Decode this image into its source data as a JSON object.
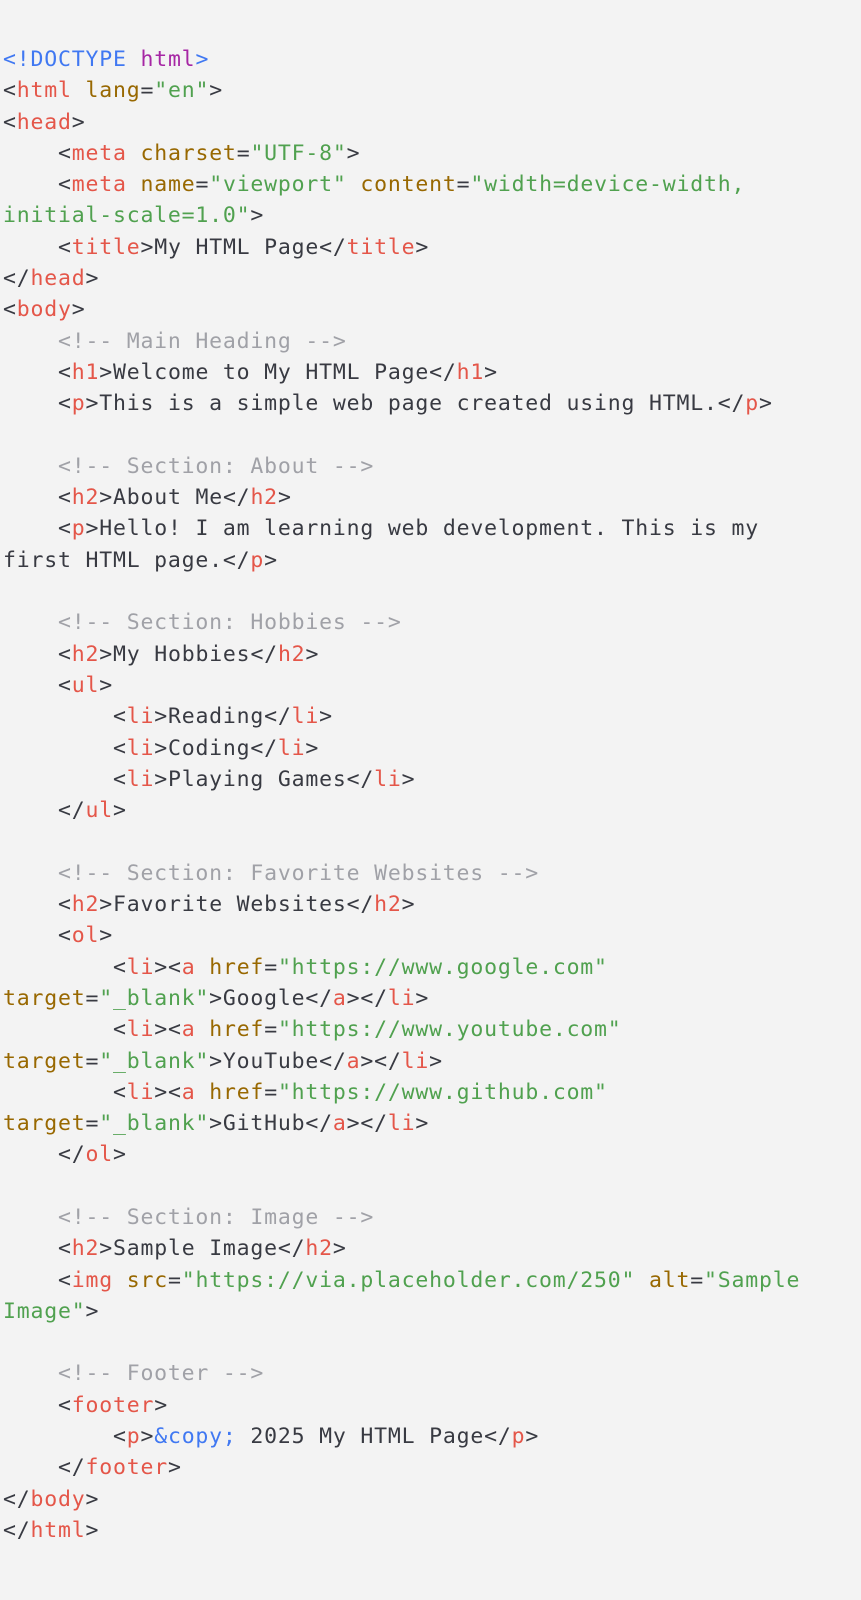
{
  "colors": {
    "background": "#f3f3f3",
    "doctype": "#4078f2",
    "keyword": "#a626a4",
    "punctuation": "#383a42",
    "tag": "#e45649",
    "attribute": "#986801",
    "string": "#50a14f",
    "text": "#383a42",
    "comment": "#a0a1a7",
    "entity": "#4078f2"
  },
  "code": {
    "lines": [
      [
        {
          "t": "doctype",
          "v": "<!DOCTYPE "
        },
        {
          "t": "kw",
          "v": "html"
        },
        {
          "t": "doctype",
          "v": ">"
        }
      ],
      [
        {
          "t": "punc",
          "v": "<"
        },
        {
          "t": "tag",
          "v": "html"
        },
        {
          "t": "punc",
          "v": " "
        },
        {
          "t": "attr",
          "v": "lang"
        },
        {
          "t": "punc",
          "v": "="
        },
        {
          "t": "str",
          "v": "\"en\""
        },
        {
          "t": "punc",
          "v": ">"
        }
      ],
      [
        {
          "t": "punc",
          "v": "<"
        },
        {
          "t": "tag",
          "v": "head"
        },
        {
          "t": "punc",
          "v": ">"
        }
      ],
      [
        {
          "t": "punc",
          "v": "    <"
        },
        {
          "t": "tag",
          "v": "meta"
        },
        {
          "t": "punc",
          "v": " "
        },
        {
          "t": "attr",
          "v": "charset"
        },
        {
          "t": "punc",
          "v": "="
        },
        {
          "t": "str",
          "v": "\"UTF-8\""
        },
        {
          "t": "punc",
          "v": ">"
        }
      ],
      [
        {
          "t": "punc",
          "v": "    <"
        },
        {
          "t": "tag",
          "v": "meta"
        },
        {
          "t": "punc",
          "v": " "
        },
        {
          "t": "attr",
          "v": "name"
        },
        {
          "t": "punc",
          "v": "="
        },
        {
          "t": "str",
          "v": "\"viewport\""
        },
        {
          "t": "punc",
          "v": " "
        },
        {
          "t": "attr",
          "v": "content"
        },
        {
          "t": "punc",
          "v": "="
        },
        {
          "t": "str",
          "v": "\"width=device-width,"
        }
      ],
      [
        {
          "t": "str",
          "v": "initial-scale=1.0\""
        },
        {
          "t": "punc",
          "v": ">"
        }
      ],
      [
        {
          "t": "punc",
          "v": "    <"
        },
        {
          "t": "tag",
          "v": "title"
        },
        {
          "t": "punc",
          "v": ">"
        },
        {
          "t": "text",
          "v": "My HTML Page"
        },
        {
          "t": "punc",
          "v": "</"
        },
        {
          "t": "tag",
          "v": "title"
        },
        {
          "t": "punc",
          "v": ">"
        }
      ],
      [
        {
          "t": "punc",
          "v": "</"
        },
        {
          "t": "tag",
          "v": "head"
        },
        {
          "t": "punc",
          "v": ">"
        }
      ],
      [
        {
          "t": "punc",
          "v": "<"
        },
        {
          "t": "tag",
          "v": "body"
        },
        {
          "t": "punc",
          "v": ">"
        }
      ],
      [
        {
          "t": "comment",
          "v": "    <!-- Main Heading -->"
        }
      ],
      [
        {
          "t": "punc",
          "v": "    <"
        },
        {
          "t": "tag",
          "v": "h1"
        },
        {
          "t": "punc",
          "v": ">"
        },
        {
          "t": "text",
          "v": "Welcome to My HTML Page"
        },
        {
          "t": "punc",
          "v": "</"
        },
        {
          "t": "tag",
          "v": "h1"
        },
        {
          "t": "punc",
          "v": ">"
        }
      ],
      [
        {
          "t": "punc",
          "v": "    <"
        },
        {
          "t": "tag",
          "v": "p"
        },
        {
          "t": "punc",
          "v": ">"
        },
        {
          "t": "text",
          "v": "This is a simple web page created using HTML."
        },
        {
          "t": "punc",
          "v": "</"
        },
        {
          "t": "tag",
          "v": "p"
        },
        {
          "t": "punc",
          "v": ">"
        }
      ],
      [],
      [
        {
          "t": "comment",
          "v": "    <!-- Section: About -->"
        }
      ],
      [
        {
          "t": "punc",
          "v": "    <"
        },
        {
          "t": "tag",
          "v": "h2"
        },
        {
          "t": "punc",
          "v": ">"
        },
        {
          "t": "text",
          "v": "About Me"
        },
        {
          "t": "punc",
          "v": "</"
        },
        {
          "t": "tag",
          "v": "h2"
        },
        {
          "t": "punc",
          "v": ">"
        }
      ],
      [
        {
          "t": "punc",
          "v": "    <"
        },
        {
          "t": "tag",
          "v": "p"
        },
        {
          "t": "punc",
          "v": ">"
        },
        {
          "t": "text",
          "v": "Hello! I am learning web development. This is my"
        }
      ],
      [
        {
          "t": "text",
          "v": "first HTML page."
        },
        {
          "t": "punc",
          "v": "</"
        },
        {
          "t": "tag",
          "v": "p"
        },
        {
          "t": "punc",
          "v": ">"
        }
      ],
      [],
      [
        {
          "t": "comment",
          "v": "    <!-- Section: Hobbies -->"
        }
      ],
      [
        {
          "t": "punc",
          "v": "    <"
        },
        {
          "t": "tag",
          "v": "h2"
        },
        {
          "t": "punc",
          "v": ">"
        },
        {
          "t": "text",
          "v": "My Hobbies"
        },
        {
          "t": "punc",
          "v": "</"
        },
        {
          "t": "tag",
          "v": "h2"
        },
        {
          "t": "punc",
          "v": ">"
        }
      ],
      [
        {
          "t": "punc",
          "v": "    <"
        },
        {
          "t": "tag",
          "v": "ul"
        },
        {
          "t": "punc",
          "v": ">"
        }
      ],
      [
        {
          "t": "punc",
          "v": "        <"
        },
        {
          "t": "tag",
          "v": "li"
        },
        {
          "t": "punc",
          "v": ">"
        },
        {
          "t": "text",
          "v": "Reading"
        },
        {
          "t": "punc",
          "v": "</"
        },
        {
          "t": "tag",
          "v": "li"
        },
        {
          "t": "punc",
          "v": ">"
        }
      ],
      [
        {
          "t": "punc",
          "v": "        <"
        },
        {
          "t": "tag",
          "v": "li"
        },
        {
          "t": "punc",
          "v": ">"
        },
        {
          "t": "text",
          "v": "Coding"
        },
        {
          "t": "punc",
          "v": "</"
        },
        {
          "t": "tag",
          "v": "li"
        },
        {
          "t": "punc",
          "v": ">"
        }
      ],
      [
        {
          "t": "punc",
          "v": "        <"
        },
        {
          "t": "tag",
          "v": "li"
        },
        {
          "t": "punc",
          "v": ">"
        },
        {
          "t": "text",
          "v": "Playing Games"
        },
        {
          "t": "punc",
          "v": "</"
        },
        {
          "t": "tag",
          "v": "li"
        },
        {
          "t": "punc",
          "v": ">"
        }
      ],
      [
        {
          "t": "punc",
          "v": "    </"
        },
        {
          "t": "tag",
          "v": "ul"
        },
        {
          "t": "punc",
          "v": ">"
        }
      ],
      [],
      [
        {
          "t": "comment",
          "v": "    <!-- Section: Favorite Websites -->"
        }
      ],
      [
        {
          "t": "punc",
          "v": "    <"
        },
        {
          "t": "tag",
          "v": "h2"
        },
        {
          "t": "punc",
          "v": ">"
        },
        {
          "t": "text",
          "v": "Favorite Websites"
        },
        {
          "t": "punc",
          "v": "</"
        },
        {
          "t": "tag",
          "v": "h2"
        },
        {
          "t": "punc",
          "v": ">"
        }
      ],
      [
        {
          "t": "punc",
          "v": "    <"
        },
        {
          "t": "tag",
          "v": "ol"
        },
        {
          "t": "punc",
          "v": ">"
        }
      ],
      [
        {
          "t": "punc",
          "v": "        <"
        },
        {
          "t": "tag",
          "v": "li"
        },
        {
          "t": "punc",
          "v": "><"
        },
        {
          "t": "tag",
          "v": "a"
        },
        {
          "t": "punc",
          "v": " "
        },
        {
          "t": "attr",
          "v": "href"
        },
        {
          "t": "punc",
          "v": "="
        },
        {
          "t": "str",
          "v": "\"https://www.google.com\""
        }
      ],
      [
        {
          "t": "attr",
          "v": "target"
        },
        {
          "t": "punc",
          "v": "="
        },
        {
          "t": "str",
          "v": "\"_blank\""
        },
        {
          "t": "punc",
          "v": ">"
        },
        {
          "t": "text",
          "v": "Google"
        },
        {
          "t": "punc",
          "v": "</"
        },
        {
          "t": "tag",
          "v": "a"
        },
        {
          "t": "punc",
          "v": "></"
        },
        {
          "t": "tag",
          "v": "li"
        },
        {
          "t": "punc",
          "v": ">"
        }
      ],
      [
        {
          "t": "punc",
          "v": "        <"
        },
        {
          "t": "tag",
          "v": "li"
        },
        {
          "t": "punc",
          "v": "><"
        },
        {
          "t": "tag",
          "v": "a"
        },
        {
          "t": "punc",
          "v": " "
        },
        {
          "t": "attr",
          "v": "href"
        },
        {
          "t": "punc",
          "v": "="
        },
        {
          "t": "str",
          "v": "\"https://www.youtube.com\""
        }
      ],
      [
        {
          "t": "attr",
          "v": "target"
        },
        {
          "t": "punc",
          "v": "="
        },
        {
          "t": "str",
          "v": "\"_blank\""
        },
        {
          "t": "punc",
          "v": ">"
        },
        {
          "t": "text",
          "v": "YouTube"
        },
        {
          "t": "punc",
          "v": "</"
        },
        {
          "t": "tag",
          "v": "a"
        },
        {
          "t": "punc",
          "v": "></"
        },
        {
          "t": "tag",
          "v": "li"
        },
        {
          "t": "punc",
          "v": ">"
        }
      ],
      [
        {
          "t": "punc",
          "v": "        <"
        },
        {
          "t": "tag",
          "v": "li"
        },
        {
          "t": "punc",
          "v": "><"
        },
        {
          "t": "tag",
          "v": "a"
        },
        {
          "t": "punc",
          "v": " "
        },
        {
          "t": "attr",
          "v": "href"
        },
        {
          "t": "punc",
          "v": "="
        },
        {
          "t": "str",
          "v": "\"https://www.github.com\""
        }
      ],
      [
        {
          "t": "attr",
          "v": "target"
        },
        {
          "t": "punc",
          "v": "="
        },
        {
          "t": "str",
          "v": "\"_blank\""
        },
        {
          "t": "punc",
          "v": ">"
        },
        {
          "t": "text",
          "v": "GitHub"
        },
        {
          "t": "punc",
          "v": "</"
        },
        {
          "t": "tag",
          "v": "a"
        },
        {
          "t": "punc",
          "v": "></"
        },
        {
          "t": "tag",
          "v": "li"
        },
        {
          "t": "punc",
          "v": ">"
        }
      ],
      [
        {
          "t": "punc",
          "v": "    </"
        },
        {
          "t": "tag",
          "v": "ol"
        },
        {
          "t": "punc",
          "v": ">"
        }
      ],
      [],
      [
        {
          "t": "comment",
          "v": "    <!-- Section: Image -->"
        }
      ],
      [
        {
          "t": "punc",
          "v": "    <"
        },
        {
          "t": "tag",
          "v": "h2"
        },
        {
          "t": "punc",
          "v": ">"
        },
        {
          "t": "text",
          "v": "Sample Image"
        },
        {
          "t": "punc",
          "v": "</"
        },
        {
          "t": "tag",
          "v": "h2"
        },
        {
          "t": "punc",
          "v": ">"
        }
      ],
      [
        {
          "t": "punc",
          "v": "    <"
        },
        {
          "t": "tag",
          "v": "img"
        },
        {
          "t": "punc",
          "v": " "
        },
        {
          "t": "attr",
          "v": "src"
        },
        {
          "t": "punc",
          "v": "="
        },
        {
          "t": "str",
          "v": "\"https://via.placeholder.com/250\""
        },
        {
          "t": "punc",
          "v": " "
        },
        {
          "t": "attr",
          "v": "alt"
        },
        {
          "t": "punc",
          "v": "="
        },
        {
          "t": "str",
          "v": "\"Sample"
        }
      ],
      [
        {
          "t": "str",
          "v": "Image\""
        },
        {
          "t": "punc",
          "v": ">"
        }
      ],
      [],
      [
        {
          "t": "comment",
          "v": "    <!-- Footer -->"
        }
      ],
      [
        {
          "t": "punc",
          "v": "    <"
        },
        {
          "t": "tag",
          "v": "footer"
        },
        {
          "t": "punc",
          "v": ">"
        }
      ],
      [
        {
          "t": "punc",
          "v": "        <"
        },
        {
          "t": "tag",
          "v": "p"
        },
        {
          "t": "punc",
          "v": ">"
        },
        {
          "t": "entity",
          "v": "&copy;"
        },
        {
          "t": "text",
          "v": " 2025 My HTML Page"
        },
        {
          "t": "punc",
          "v": "</"
        },
        {
          "t": "tag",
          "v": "p"
        },
        {
          "t": "punc",
          "v": ">"
        }
      ],
      [
        {
          "t": "punc",
          "v": "    </"
        },
        {
          "t": "tag",
          "v": "footer"
        },
        {
          "t": "punc",
          "v": ">"
        }
      ],
      [
        {
          "t": "punc",
          "v": "</"
        },
        {
          "t": "tag",
          "v": "body"
        },
        {
          "t": "punc",
          "v": ">"
        }
      ],
      [
        {
          "t": "punc",
          "v": "</"
        },
        {
          "t": "tag",
          "v": "html"
        },
        {
          "t": "punc",
          "v": ">"
        }
      ]
    ]
  }
}
